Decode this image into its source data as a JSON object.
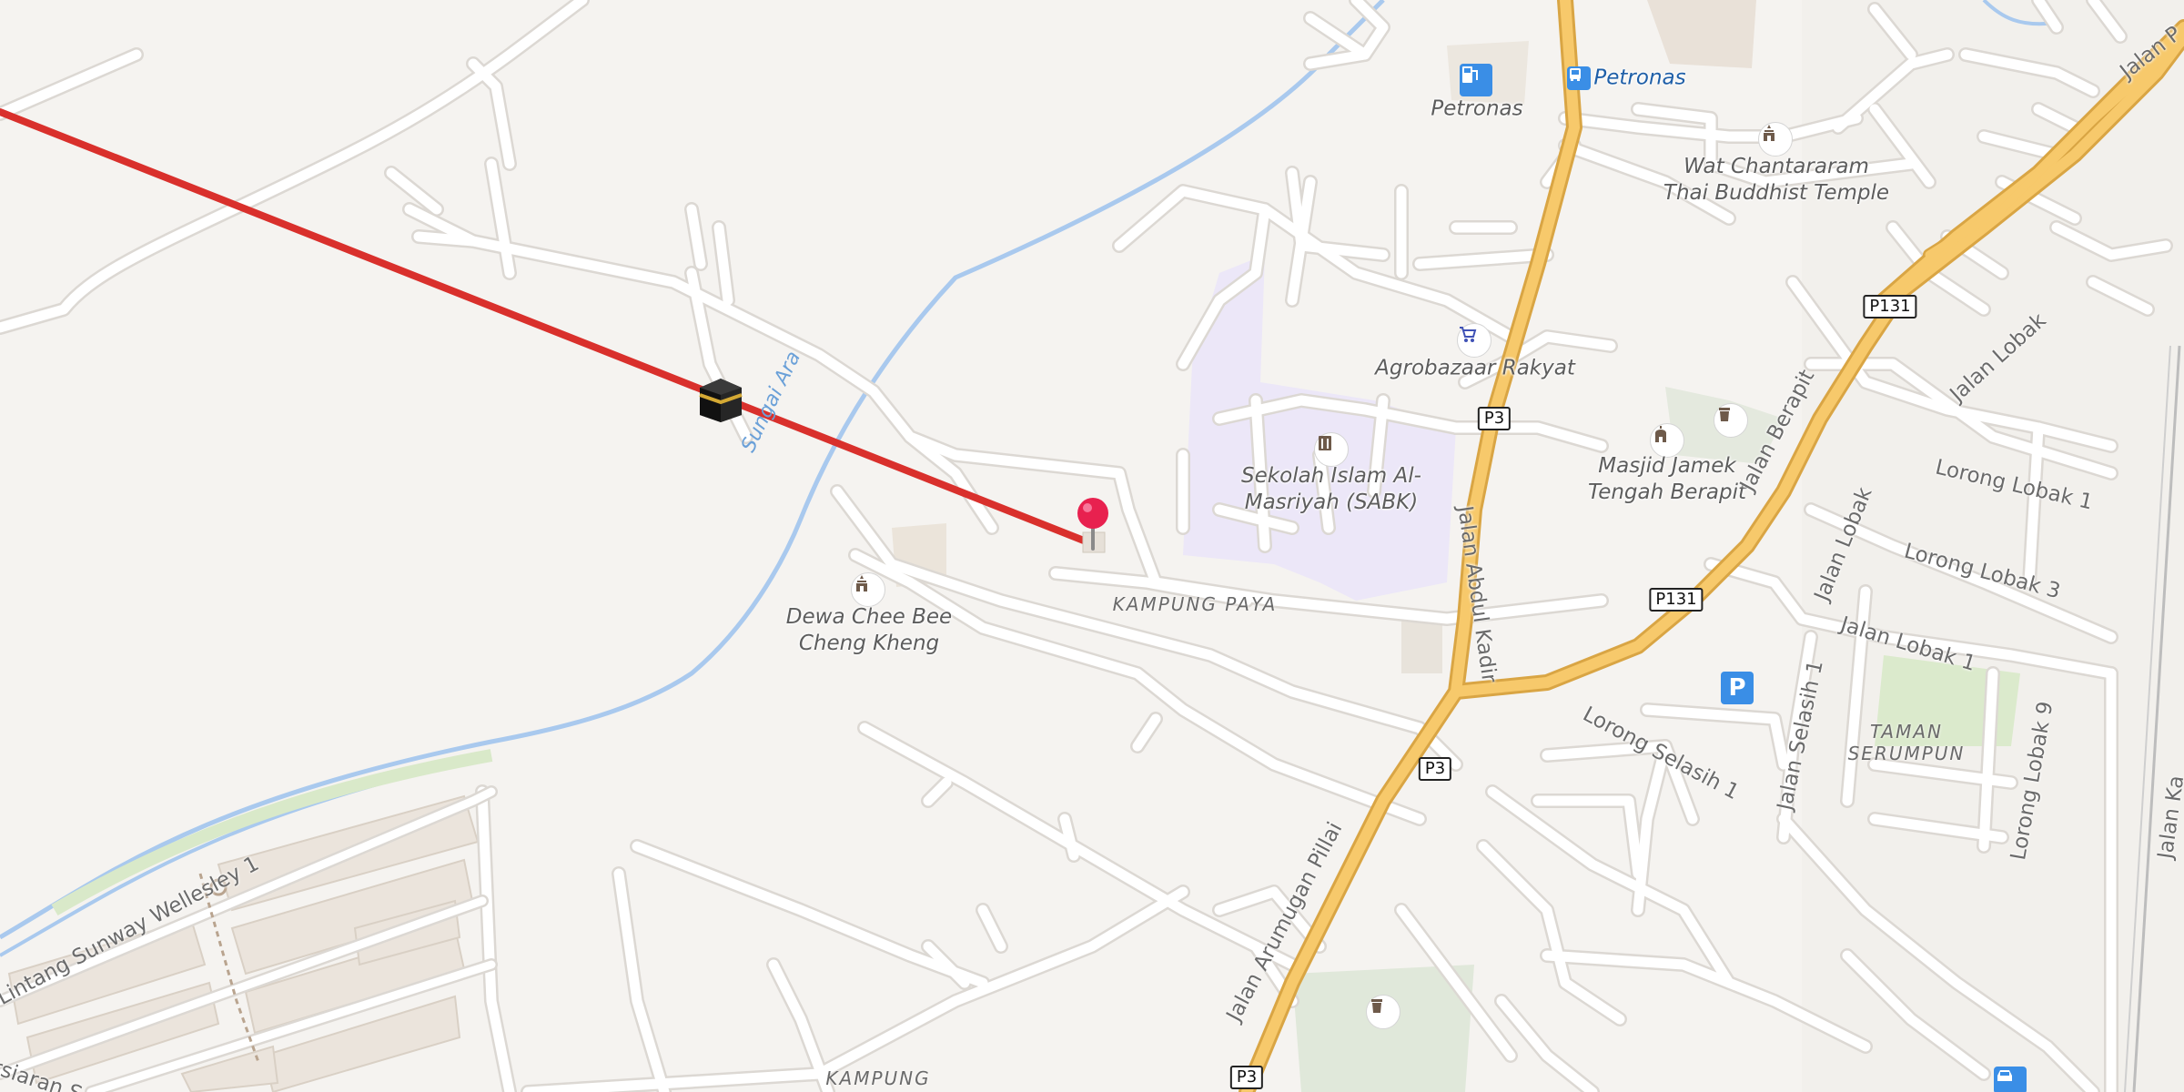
{
  "map": {
    "colors": {
      "background": "#f5f3f0",
      "road": "#ffffff",
      "road_casing": "#dcd8d3",
      "highway": "#f7c96b",
      "highway_casing": "#d9a544",
      "river": "#a9c9ee",
      "school_area": "#ece7f8",
      "green_area": "#dfe8d6",
      "qibla_line": "#d9302c",
      "pin": "#e8214f"
    },
    "labels": {
      "petronas_station": "Petronas",
      "petronas_bus": "Petronas",
      "wat_temple": "Wat Chantararam\nThai Buddhist Temple",
      "agrobazaar": "Agrobazaar Rakyat",
      "sekolah": "Sekolah Islam Al-\nMasriyah (SABK)",
      "masjid": "Masjid Jamek\nTengah Berapit",
      "dewa_temple": "Dewa Chee Bee\nCheng Kheng"
    },
    "areas": {
      "kampung_paya": "KAMPUNG PAYA",
      "taman_serumpun": "TAMAN\nSERUMPUN",
      "kampung": "KAMPUNG"
    },
    "streets": {
      "jalan_abdul_kadir": "Jalan Abdul Kadir",
      "jalan_arumugan_pillai": "Jalan Arumugan Pillai",
      "jalan_berapit": "Jalan Berapit",
      "jalan_lobak": "Jalan Lobak",
      "jalan_lobak_2": "Jalan Lobak",
      "lorong_lobak_1": "Lorong Lobak 1",
      "lorong_lobak_3": "Lorong Lobak 3",
      "jalan_lobak_1": "Jalan Lobak 1",
      "lorong_lobak_9": "Lorong Lobak 9",
      "jalan_selasih_1": "Jalan Selasih 1",
      "lorong_selasih_1": "Lorong Selasih 1",
      "lintang_sunway": "Lintang Sunway Wellesley 1",
      "persiaran_partial": "rsiaran S",
      "jalan_top_right": "Jalan P",
      "jalan_right_edge": "Jalan Ka"
    },
    "river_name": "Sungai Ara",
    "shields": {
      "p131_a": "P131",
      "p131_b": "P131",
      "p3_a": "P3",
      "p3_b": "P3",
      "p3_c": "P3"
    },
    "markers": {
      "parking": "P"
    },
    "icons": [
      "fuel-icon",
      "bus-stop-icon",
      "temple-icon",
      "shopping-cart-icon",
      "school-icon",
      "mosque-icon",
      "parking-icon",
      "kaaba-icon",
      "location-pin-icon",
      "car-icon",
      "cemetery-icon"
    ]
  }
}
